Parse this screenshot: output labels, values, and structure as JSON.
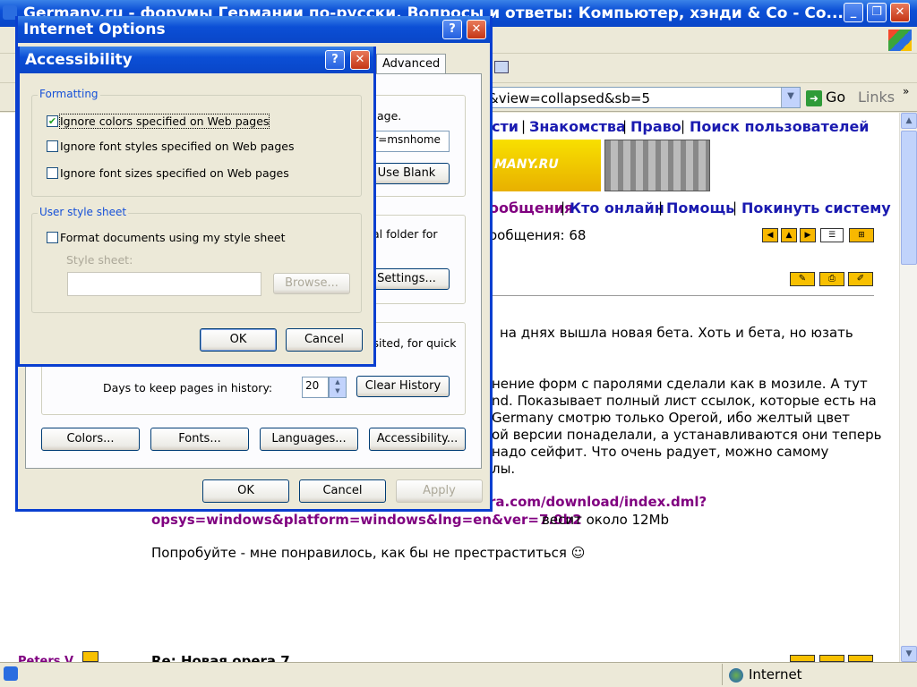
{
  "ie": {
    "title": "Germany.ru - форумы Германии по-русски. Вопросы и ответы: Компьютер, хэнди & Co - Co...",
    "address_value": "&view=collapsed&sb=5",
    "go_label": "Go",
    "links_label": "Links",
    "status_zone": "Internet"
  },
  "page": {
    "nav1": [
      "сти",
      "Знакомства",
      "Право",
      "Поиск пользователей"
    ],
    "nav2": [
      "ообщения",
      "Кто онлайн",
      "Помощь",
      "Покинуть систему"
    ],
    "banner_text": "MANY.RU",
    "post_count": "ообщения: 68",
    "post_lines": [
      "на днях вышла новая бета. Хоть и бета, но юзать",
      "нение форм с паролями сделали как в мозиле. А тут",
      "nd. Показывает полный лист ссылок, которые есть на",
      "Germany смотрю только Operой, ибо желтый цвет",
      "ой версии понаделали, а устанавливаются они теперь",
      "надо сейфит. Что очень радует, можно самому",
      "лы."
    ],
    "link_line1": "ra.com/download/index.dml?",
    "link_line2": "opsys=windows&platform=windows&lng=en&ver=7.0b2",
    "link_suffix": " весит около 12Mb",
    "closing": "Попробуйте - мне понравилось, как бы не престраститься ☺",
    "next_post_title": "Re: Новая opera 7",
    "sidebar_user": "Peters V."
  },
  "internet_options": {
    "title": "Internet Options",
    "tab_advanced": "Advanced",
    "home_text": "age.",
    "home_value": "ar=msnhome",
    "use_blank": "Use Blank",
    "temp_text": "al folder for",
    "settings": "Settings...",
    "history_text": "isited, for quick",
    "days_label": "Days to keep pages in history:",
    "days_value": "20",
    "clear_history": "Clear History",
    "buttons": [
      "Colors...",
      "Fonts...",
      "Languages...",
      "Accessibility..."
    ],
    "ok": "OK",
    "cancel": "Cancel",
    "apply": "Apply"
  },
  "accessibility": {
    "title": "Accessibility",
    "formatting_group": "Formatting",
    "checks": [
      {
        "label": "Ignore colors specified on Web pages",
        "checked": true
      },
      {
        "label": "Ignore font styles specified on Web pages",
        "checked": false
      },
      {
        "label": "Ignore font sizes specified on Web pages",
        "checked": false
      }
    ],
    "stylesheet_group": "User style sheet",
    "format_docs": "Format documents using my style sheet",
    "format_docs_checked": false,
    "stylesheet_label": "Style sheet:",
    "stylesheet_value": "",
    "browse": "Browse...",
    "ok": "OK",
    "cancel": "Cancel"
  },
  "colors": {
    "titlebar": "#0b4fd6",
    "link": "#1a1ab0",
    "visited": "#800080",
    "groupbox_title": "#1550d8",
    "check": "#21a121"
  }
}
